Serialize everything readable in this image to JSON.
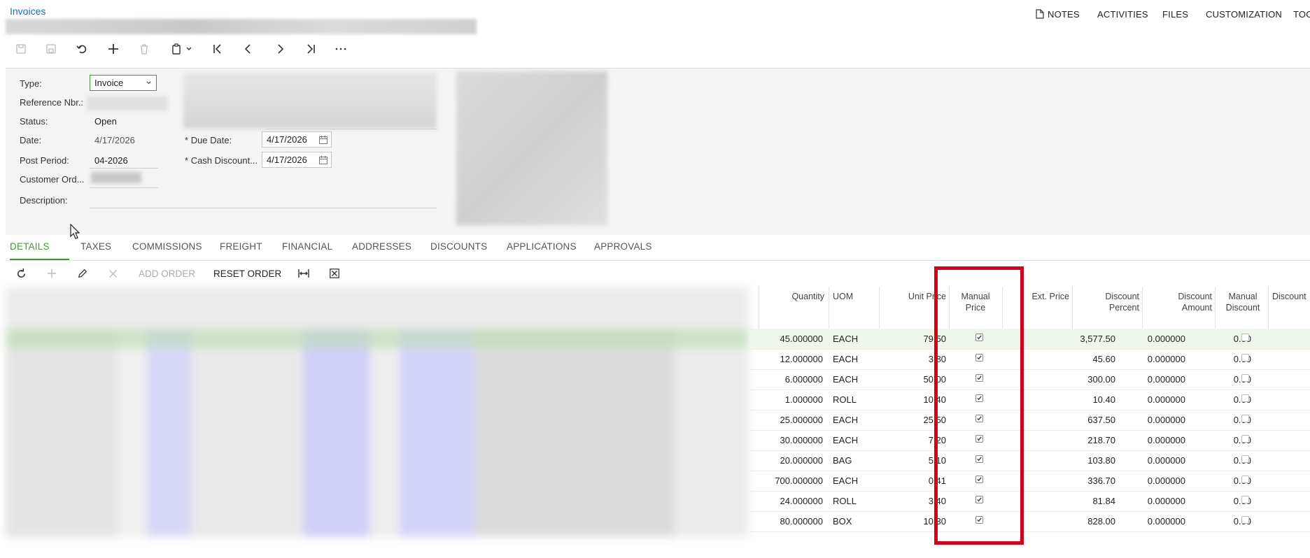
{
  "screen": {
    "title": "Invoices"
  },
  "topnav": {
    "notes": "NOTES",
    "activities": "ACTIVITIES",
    "files": "FILES",
    "customization": "CUSTOMIZATION",
    "tools": "TOO"
  },
  "form": {
    "type_label": "Type:",
    "type_value": "Invoice",
    "ref_label": "Reference Nbr.:",
    "status_label": "Status:",
    "status_value": "Open",
    "date_label": "Date:",
    "date_value": "4/17/2026",
    "post_period_label": "Post Period:",
    "post_period_value": "04-2026",
    "customer_order_label": "Customer Ord...",
    "description_label": "Description:",
    "due_date_label": "Due Date:",
    "due_date_value": "4/17/2026",
    "cash_discount_label": "Cash Discount...",
    "cash_discount_value": "4/17/2026",
    "required_mark": "*"
  },
  "tabs": [
    "DETAILS",
    "TAXES",
    "COMMISSIONS",
    "FREIGHT",
    "FINANCIAL",
    "ADDRESSES",
    "DISCOUNTS",
    "APPLICATIONS",
    "APPROVALS"
  ],
  "grid_toolbar": {
    "add_order": "ADD ORDER",
    "reset_order": "RESET ORDER"
  },
  "columns": {
    "quantity": "Quantity",
    "uom": "UOM",
    "unit_price": "Unit Price",
    "manual_price_1": "Manual",
    "manual_price_2": "Price",
    "ext_price": "Ext. Price",
    "discount_percent_1": "Discount",
    "discount_percent_2": "Percent",
    "discount_amount_1": "Discount",
    "discount_amount_2": "Amount",
    "manual_discount_1": "Manual",
    "manual_discount_2": "Discount",
    "discount": "Discount"
  },
  "rows": [
    {
      "quantity": "45.000000",
      "uom": "EACH",
      "unit_price": "79.5",
      "unit_price_tail": "0",
      "manual_price": true,
      "ext_price": "3,577.50",
      "discount_percent": "0.000000",
      "discount_amount": "0.00",
      "manual_discount": false
    },
    {
      "quantity": "12.000000",
      "uom": "EACH",
      "unit_price": "3.8",
      "unit_price_tail": "0",
      "manual_price": true,
      "ext_price": "45.60",
      "discount_percent": "0.000000",
      "discount_amount": "0.00",
      "manual_discount": false
    },
    {
      "quantity": "6.000000",
      "uom": "EACH",
      "unit_price": "50.0",
      "unit_price_tail": "0",
      "manual_price": true,
      "ext_price": "300.00",
      "discount_percent": "0.000000",
      "discount_amount": "0.00",
      "manual_discount": false
    },
    {
      "quantity": "1.000000",
      "uom": "ROLL",
      "unit_price": "10.4",
      "unit_price_tail": "0",
      "manual_price": true,
      "ext_price": "10.40",
      "discount_percent": "0.000000",
      "discount_amount": "0.00",
      "manual_discount": false
    },
    {
      "quantity": "25.000000",
      "uom": "EACH",
      "unit_price": "25.5",
      "unit_price_tail": "0",
      "manual_price": true,
      "ext_price": "637.50",
      "discount_percent": "0.000000",
      "discount_amount": "0.00",
      "manual_discount": false
    },
    {
      "quantity": "30.000000",
      "uom": "EACH",
      "unit_price": "7.2",
      "unit_price_tail": "0",
      "manual_price": true,
      "ext_price": "218.70",
      "discount_percent": "0.000000",
      "discount_amount": "0.00",
      "manual_discount": false
    },
    {
      "quantity": "20.000000",
      "uom": "BAG",
      "unit_price": "5.1",
      "unit_price_tail": "0",
      "manual_price": true,
      "ext_price": "103.80",
      "discount_percent": "0.000000",
      "discount_amount": "0.00",
      "manual_discount": false
    },
    {
      "quantity": "700.000000",
      "uom": "EACH",
      "unit_price": "0.4",
      "unit_price_tail": "1",
      "manual_price": true,
      "ext_price": "336.70",
      "discount_percent": "0.000000",
      "discount_amount": "0.00",
      "manual_discount": false
    },
    {
      "quantity": "24.000000",
      "uom": "ROLL",
      "unit_price": "3.4",
      "unit_price_tail": "0",
      "manual_price": true,
      "ext_price": "81.84",
      "discount_percent": "0.000000",
      "discount_amount": "0.00",
      "manual_discount": false
    },
    {
      "quantity": "80.000000",
      "uom": "BOX",
      "unit_price": "10.3",
      "unit_price_tail": "0",
      "manual_price": true,
      "ext_price": "828.00",
      "discount_percent": "0.000000",
      "discount_amount": "0.00",
      "manual_discount": false
    }
  ],
  "colors": {
    "accent": "#3f9a34",
    "link": "#1a6fb5",
    "highlight": "#d0021b"
  }
}
